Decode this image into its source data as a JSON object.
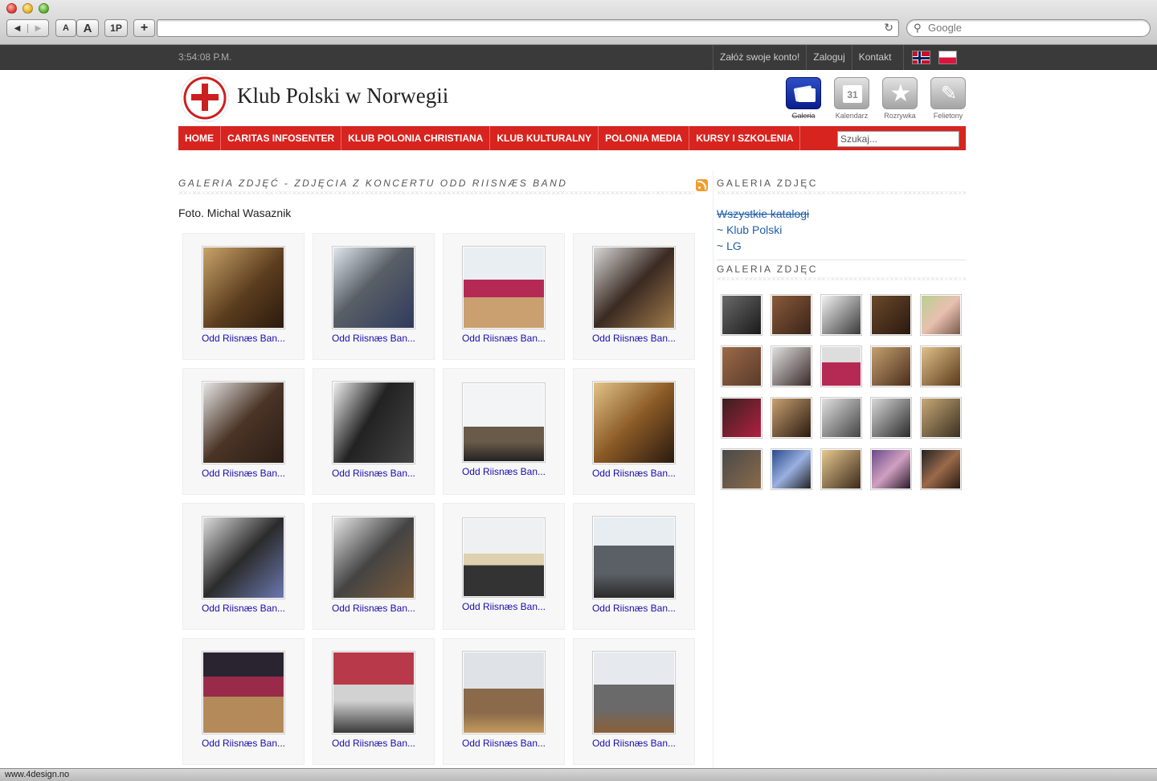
{
  "browser": {
    "font_small_label": "A",
    "font_large_label": "A",
    "one_password_label": "1P",
    "add_tab_label": "+",
    "back_icon": "◀",
    "forward_icon": "▶",
    "reload_icon": "↻",
    "search_placeholder": "Google",
    "status_url": "www.4design.no"
  },
  "topbar": {
    "clock": "3:54:08 P.M.",
    "links": [
      "Załóż swoje konto!",
      "Zaloguj",
      "Kontakt"
    ]
  },
  "header": {
    "site_title": "Klub Polski w Norwegii",
    "quick_links": [
      {
        "label": "Galeria",
        "icon": "gallery-icon",
        "active": true
      },
      {
        "label": "Kalendarz",
        "icon": "calendar-icon"
      },
      {
        "label": "Rozrywka",
        "icon": "star-icon"
      },
      {
        "label": "Felietony",
        "icon": "pen-icon"
      }
    ]
  },
  "nav": {
    "items": [
      "HOME",
      "CARITAS INFOSENTER",
      "KLUB POLONIA CHRISTIANA",
      "KLUB KULTURALNY",
      "POLONIA MEDIA",
      "KURSY I SZKOLENIA"
    ],
    "search_value": "Szukaj..."
  },
  "main": {
    "title": "GALERIA ZDJĘĆ - ZDJĘCIA Z KONCERTU ODD RIISNÆS BAND",
    "credit": "Foto. Michal Wasaznik",
    "photo_caption": "Odd Riisnæs Ban...",
    "photos": 16
  },
  "sidebar": {
    "heading1": "GALERIA ZDJĘC",
    "links": [
      "Wszystkie katalogi",
      "~ Klub Polski",
      "~ LG"
    ],
    "heading2": "GALERIA ZDJĘC"
  },
  "colors": {
    "nav_red": "#d7241f",
    "topbar": "#3a3a3a",
    "link": "#1f5ea8",
    "caption": "#1a0dab"
  }
}
